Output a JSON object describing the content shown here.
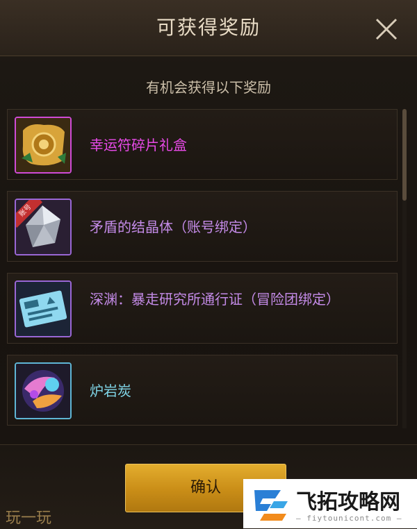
{
  "dialog": {
    "title": "可获得奖励",
    "subtitle": "有机会获得以下奖励",
    "confirm_label": "确认"
  },
  "rewards": [
    {
      "name": "幸运符碎片礼盒",
      "color": "#e84ae8",
      "icon": "lucky-charm-scroll-icon"
    },
    {
      "name": "矛盾的结晶体（账号绑定）",
      "color": "#c48be8",
      "icon": "contradiction-crystal-icon",
      "badge": "账号"
    },
    {
      "name": "深渊：暴走研究所通行证（冒险团绑定）",
      "color": "#c48be8",
      "icon": "lab-pass-ticket-icon"
    },
    {
      "name": "炉岩炭",
      "color": "#7fd4e6",
      "icon": "furnace-rock-charcoal-icon"
    }
  ],
  "watermarks": {
    "left_text": "玩一玩",
    "right_title": "飞拓攻略网",
    "right_url": "— fiytounicont.com —"
  }
}
